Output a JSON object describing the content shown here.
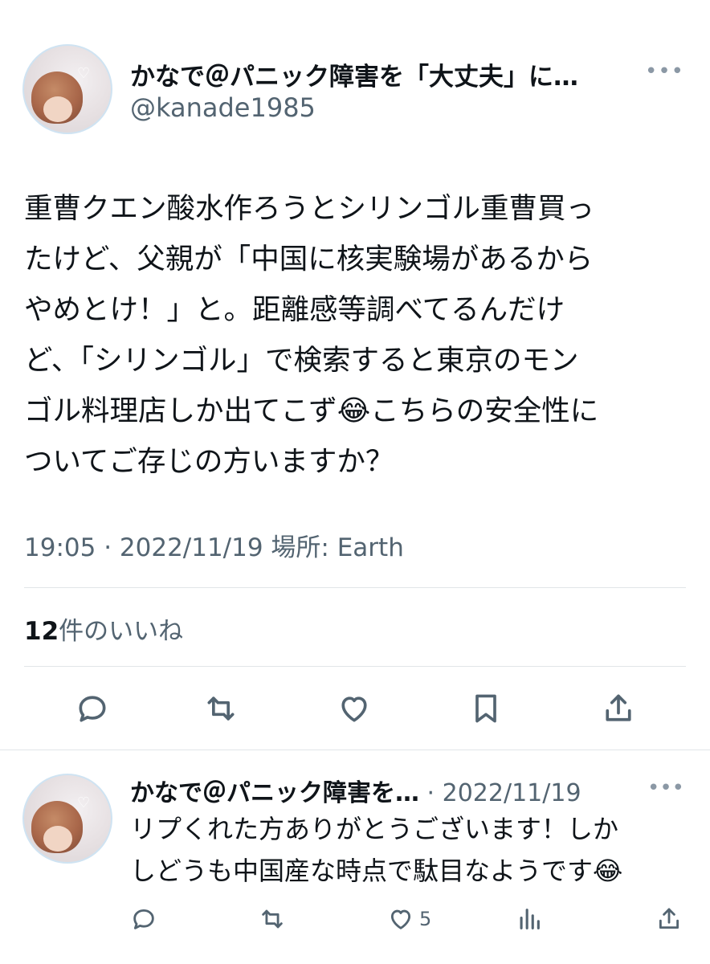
{
  "tweet": {
    "author_name": "かなで＠パニック障害を「大丈夫」に…",
    "handle": "@kanade1985",
    "more_label": "•••",
    "text_lines": [
      "重曹クエン酸水作ろうとシリンゴル重曹買っ",
      "たけど、父親が「中国に核実験場があるから",
      "やめとけ！」と。距離感等調べてるんだけ",
      "ど、「シリンゴル」で検索すると東京のモン",
      "ゴル料理店しか出てこず😂こちらの安全性に",
      "ついてご存じの方いますか？"
    ],
    "meta": "19:05 · 2022/11/19 場所: Earth",
    "likes_count": "12",
    "likes_label": "件のいいね"
  },
  "actions": {
    "reply_icon": "reply-icon",
    "retweet_icon": "retweet-icon",
    "like_icon": "heart-icon",
    "bookmark_icon": "bookmark-icon",
    "share_icon": "share-icon"
  },
  "reply": {
    "author_name": "かなで＠パニック障害を…",
    "date": "· 2022/11/19",
    "more_label": "•••",
    "text_lines": [
      "リプくれた方ありがとうございます！しか",
      "しどうも中国産な時点で駄目なようです😂"
    ],
    "like_count": "5"
  },
  "colors": {
    "text": "#0f1419",
    "secondary": "#536471",
    "divider": "#e1e5e8"
  }
}
